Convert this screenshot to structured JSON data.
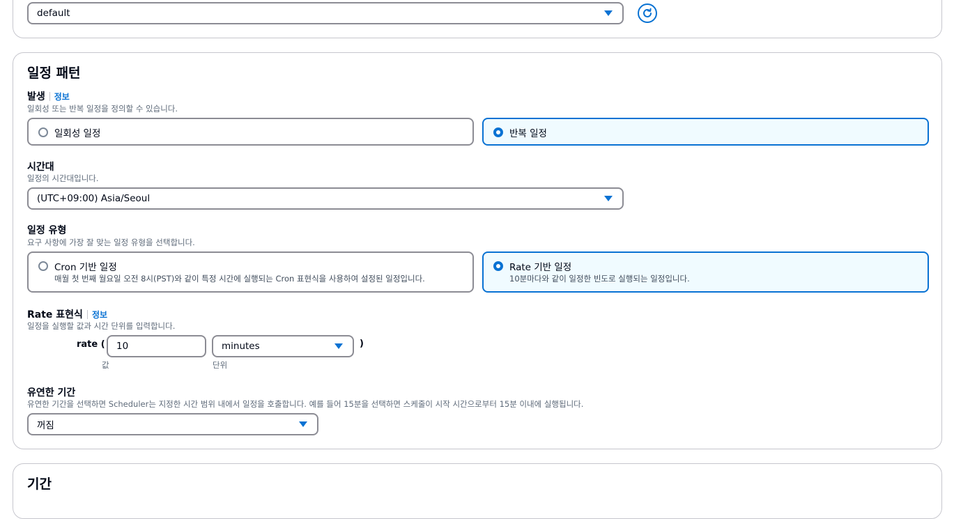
{
  "top_card": {
    "role_select_value": "default",
    "refresh_icon": "refresh-icon"
  },
  "schedule_pattern": {
    "title": "일정 패턴",
    "occurrence": {
      "label": "발생",
      "info": "정보",
      "description": "일회성 또는 반복 일정을 정의할 수 있습니다.",
      "options": [
        {
          "label": "일회성 일정",
          "selected": false
        },
        {
          "label": "반복 일정",
          "selected": true
        }
      ]
    },
    "timezone": {
      "label": "시간대",
      "description": "일정의 시간대입니다.",
      "value": "(UTC+09:00) Asia/Seoul"
    },
    "schedule_type": {
      "label": "일정 유형",
      "description": "요구 사항에 가장 잘 맞는 일정 유형을 선택합니다.",
      "options": [
        {
          "label": "Cron 기반 일정",
          "description": "매월 첫 번째 월요일 오전 8시(PST)와 같이 특정 시간에 실행되는 Cron 표현식을 사용하여 설정된 일정입니다.",
          "selected": false
        },
        {
          "label": "Rate 기반 일정",
          "description": "10분마다와 같이 일정한 빈도로 실행되는 일정입니다.",
          "selected": true
        }
      ]
    },
    "rate_expression": {
      "label": "Rate 표현식",
      "info": "정보",
      "description": "일정을 실행할 값과 시간 단위를 입력합니다.",
      "prefix": "rate (",
      "value": "10",
      "unit": "minutes",
      "suffix": ")",
      "value_label": "값",
      "unit_label": "단위"
    },
    "flexible_window": {
      "label": "유연한 기간",
      "description": "유연한 기간을 선택하면 Scheduler는 지정한 시간 범위 내에서 일정을 호출합니다. 예를 들어 15분을 선택하면 스케줄이 시작 시간으로부터 15분 이내에 실행됩니다.",
      "value": "꺼짐"
    }
  },
  "period": {
    "title": "기간"
  },
  "colors": {
    "accent": "#0972d3",
    "border": "#8c8c94",
    "selected_bg": "#f0fbff"
  }
}
